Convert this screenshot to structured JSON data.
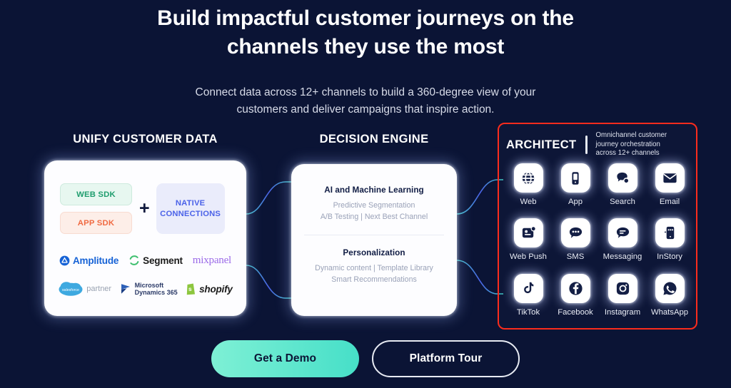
{
  "header": {
    "headline_line1": "Build impactful customer journeys on the",
    "headline_line2": "channels they use the most",
    "subhead_line1": "Connect data across 12+ channels to build a 360-degree view of your",
    "subhead_line2": "customers and deliver campaigns that inspire action."
  },
  "columns": {
    "unify_title": "UNIFY CUSTOMER DATA",
    "decision_title": "DECISION ENGINE"
  },
  "unify_card": {
    "web_sdk": "WEB SDK",
    "app_sdk": "APP SDK",
    "plus": "+",
    "native_line1": "NATIVE",
    "native_line2": "CONNECTIONS",
    "logos": [
      {
        "name": "amplitude-logo",
        "text": "Amplitude",
        "color": "#1763d6"
      },
      {
        "name": "segment-logo",
        "text": "Segment",
        "color": "#1a1a1a"
      },
      {
        "name": "mixpanel-logo",
        "text": "mixpanel",
        "color": "#9b6ae8"
      },
      {
        "name": "salesforce-partner-logo",
        "text": "partner",
        "color": "#9aa3b2"
      },
      {
        "name": "microsoft-dynamics-365-logo",
        "text": "Microsoft",
        "text2": "Dynamics 365",
        "color": "#2b3a67"
      },
      {
        "name": "shopify-logo",
        "text": "shopify",
        "color": "#1a1a1a"
      }
    ]
  },
  "decision_card": {
    "section1_title": "AI and Machine Learning",
    "section1_line1": "Predictive Segmentation",
    "section1_line2": "A/B Testing | Next Best Channel",
    "section2_title": "Personalization",
    "section2_line1": "Dynamic content | Template Library",
    "section2_line2": "Smart Recommendations"
  },
  "architect": {
    "title": "ARCHITECT",
    "subtitle_line1": "Omnichannel customer",
    "subtitle_line2": "journey orchestration",
    "subtitle_line3": "across 12+ channels",
    "border_color": "#fb2c1d",
    "channels": [
      {
        "label": "Web",
        "icon": "globe-icon"
      },
      {
        "label": "App",
        "icon": "mobile-phone-icon"
      },
      {
        "label": "Search",
        "icon": "search-bubble-icon"
      },
      {
        "label": "Email",
        "icon": "envelope-icon"
      },
      {
        "label": "Web Push",
        "icon": "web-push-icon"
      },
      {
        "label": "SMS",
        "icon": "sms-bubble-icon"
      },
      {
        "label": "Messaging",
        "icon": "messaging-bubble-icon"
      },
      {
        "label": "InStory",
        "icon": "instory-icon"
      },
      {
        "label": "TikTok",
        "icon": "tiktok-icon"
      },
      {
        "label": "Facebook",
        "icon": "facebook-icon"
      },
      {
        "label": "Instagram",
        "icon": "instagram-icon"
      },
      {
        "label": "WhatsApp",
        "icon": "whatsapp-icon"
      }
    ]
  },
  "cta": {
    "primary": "Get a Demo",
    "secondary": "Platform Tour",
    "primary_color": "#5fe7cf"
  },
  "theme": {
    "background": "#0b1435",
    "card_background": "#fdfdff",
    "accent_teal": "#46dfc8",
    "accent_red": "#fb2c1d"
  }
}
